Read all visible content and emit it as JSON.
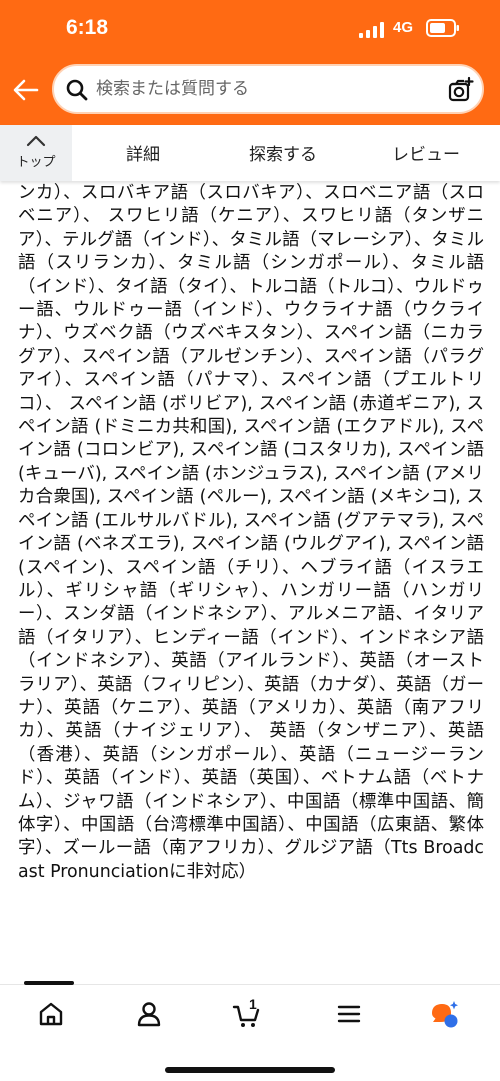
{
  "status_bar": {
    "time": "6:18",
    "network": "4G"
  },
  "search": {
    "placeholder": "検索または質問する"
  },
  "subnav": {
    "top_label": "トップ",
    "tabs": [
      {
        "label": "詳細"
      },
      {
        "label": "探索する"
      },
      {
        "label": "レビュー"
      }
    ]
  },
  "content": {
    "languages_text": "ンカ）、スロバキア語（スロバキア）、スロベニア語（スロベニア）、 スワヒリ語（ケニア）、スワヒリ語（タンザニア）、テルグ語（インド）、タミル語（マレーシア）、タミル語（スリランカ）、タミル語（シンガポール）、タミル語（インド）、タイ語（タイ）、トルコ語（トルコ）、ウルドゥー語、ウルドゥー語（インド）、ウクライナ語（ウクライナ）、ウズベク語（ウズベキスタン）、スペイン語（ニカラグア）、スペイン語（アルゼンチン）、スペイン語（パラグアイ）、スペイン語（パナマ）、スペイン語（プエルトリコ）、 スペイン語 (ボリビア), スペイン語 (赤道ギニア), スペイン語 (ドミニカ共和国), スペイン語 (エクアドル), スペイン語 (コロンビア), スペイン語 (コスタリカ), スペイン語 (キューバ), スペイン語 (ホンジュラス), スペイン語 (アメリカ合衆国), スペイン語 (ペルー), スペイン語 (メキシコ), スペイン語 (エルサルバドル), スペイン語 (グアテマラ), スペイン語 (ベネズエラ), スペイン語 (ウルグアイ), スペイン語 (スペイン)、スペイン語（チリ）、ヘブライ語（イスラエル）、ギリシャ語（ギリシャ）、ハンガリー語（ハンガリー）、スンダ語（インドネシア）、アルメニア語、イタリア語（イタリア）、ヒンディー語（インド）、インドネシア語（インドネシア）、英語（アイルランド）、英語（オーストラリア）、英語（フィリピン）、英語（カナダ）、英語（ガーナ）、英語（ケニア）、英語（アメリカ）、英語（南アフリカ）、英語（ナイジェリア）、 英語（タンザニア）、英語（香港）、英語（シンガポール）、英語（ニュージーランド）、英語（インド）、英語（英国）、ベトナム語（ベトナム）、ジャワ語（インドネシア）、中国語（標準中国語、簡体字）、中国語（台湾標準中国語）、中国語（広東語、繁体字）、ズールー語（南アフリカ）、グルジア語（Tts Broadcast Pronunciationに非対応）"
  },
  "bottom_nav": {
    "items": [
      {
        "icon": "home-icon"
      },
      {
        "icon": "account-icon"
      },
      {
        "icon": "cart-icon"
      },
      {
        "icon": "menu-icon"
      },
      {
        "icon": "assistant-icon"
      }
    ],
    "cart_count": "1"
  },
  "colors": {
    "header_bg": "#ff6a13",
    "assistant_orange": "#ff6a13",
    "assistant_blue": "#2f6fe8"
  }
}
